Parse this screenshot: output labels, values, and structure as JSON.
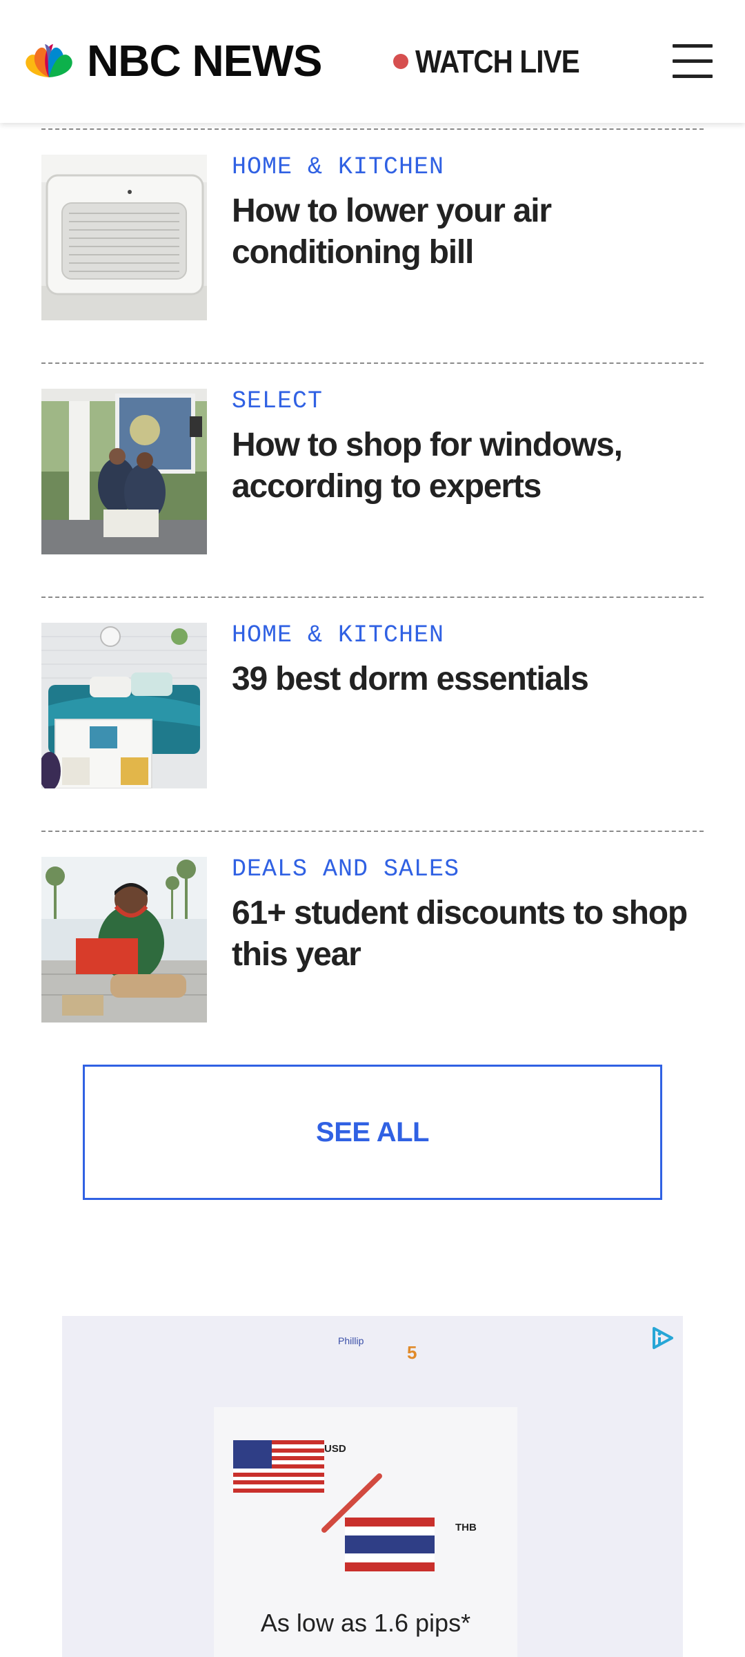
{
  "header": {
    "logo_text": "NBC NEWS",
    "watch_live_label": "WATCH LIVE"
  },
  "articles": [
    {
      "category": "HOME & KITCHEN",
      "headline": "How to lower your air conditioning bill",
      "image": "air-conditioner"
    },
    {
      "category": "SELECT",
      "headline": "How to shop for windows, according to experts",
      "image": "window-installers"
    },
    {
      "category": "HOME & KITCHEN",
      "headline": "39 best dorm essentials",
      "image": "dorm-bed"
    },
    {
      "category": "DEALS AND SALES",
      "headline": "61+ student discounts to shop this year",
      "image": "student-laptop"
    }
  ],
  "see_all_label": "SEE ALL",
  "ad": {
    "brand": "Phillip",
    "number": "5",
    "usd_label": "USD",
    "thb_label": "THB",
    "tagline": "As low as 1.6 pips*"
  },
  "colors": {
    "accent_blue": "#3061e3",
    "live_dot": "#d64f4f",
    "headline": "#222222"
  }
}
